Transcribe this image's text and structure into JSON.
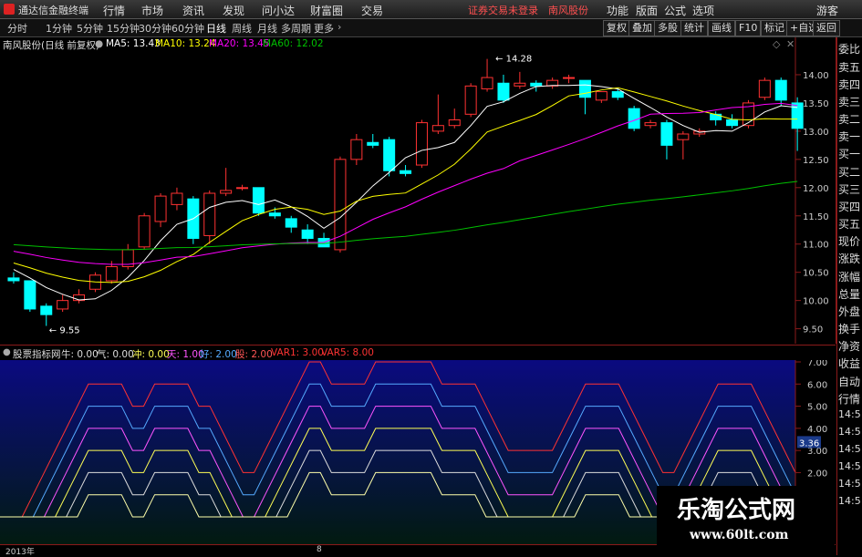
{
  "menu": {
    "app_name": "通达信金融终端",
    "items": [
      "行情",
      "市场",
      "资讯",
      "发现",
      "问小达",
      "财富圈",
      "交易"
    ],
    "notice": "证券交易未登录　南风股份",
    "right_items": [
      "功能",
      "版面",
      "公式",
      "选项",
      "游客"
    ]
  },
  "toolbar": {
    "tabs": [
      "分时",
      "1分钟",
      "5分钟",
      "15分钟",
      "30分钟",
      "60分钟",
      "日线",
      "周线",
      "月线",
      "多周期",
      "更多"
    ],
    "active_tab": "日线",
    "right_buttons": [
      "复权",
      "叠加",
      "多股",
      "统计",
      "画线",
      "F10",
      "标记",
      "+自选",
      "返回"
    ]
  },
  "chart_header": {
    "stock": "南风股份(日线 前复权)",
    "ma5": "MA5: 13.43",
    "ma10": "MA10: 13.24",
    "ma20": "MA20: 13.45",
    "ma60": "MA60: 12.02",
    "high_label": "14.28",
    "low_label": "9.55"
  },
  "sub_header": {
    "name": "股票指标网",
    "items": [
      {
        "label": "牛: 0.00",
        "color": "#dddddd"
      },
      {
        "label": "气: 0.00",
        "color": "#dddddd"
      },
      {
        "label": "冲: 0.00",
        "color": "#ffff55"
      },
      {
        "label": "天: 1.00",
        "color": "#ff55ff"
      },
      {
        "label": "好: 2.00",
        "color": "#55aaff"
      },
      {
        "label": "股: 2.00",
        "color": "#ff5555"
      },
      {
        "label": "VAR1: 3.00",
        "color": "#ff3333"
      },
      {
        "label": "VAR5: 8.00",
        "color": "#ff3333"
      }
    ],
    "current_value": "3.36"
  },
  "sidebar": {
    "items": [
      "委比",
      "卖五",
      "卖四",
      "卖三",
      "卖二",
      "卖一",
      "买一",
      "买二",
      "买三",
      "买四",
      "买五",
      "现价",
      "涨跌",
      "涨幅",
      "总量",
      "外盘",
      "换手",
      "净资",
      "收益",
      "自动",
      "行情",
      "14:5",
      "14:5",
      "14:5",
      "14:5",
      "14:5",
      "14:5"
    ]
  },
  "bottom": {
    "year_label": "2013年",
    "month_label": "8"
  },
  "watermark": {
    "title": "乐淘公式网",
    "url": "www.60lt.com"
  },
  "colors": {
    "up": "#ff3232",
    "down": "#00ffff",
    "ma5": "#ffffff",
    "ma10": "#ffff00",
    "ma20": "#ff00ff",
    "ma60": "#00c000",
    "subbg": "#0a0a78"
  },
  "chart_data": {
    "type": "candlestick",
    "ylim": [
      9.3,
      14.5
    ],
    "yticks": [
      9.5,
      10.0,
      10.5,
      11.0,
      11.5,
      12.0,
      12.5,
      13.0,
      13.5,
      14.0
    ],
    "candles": [
      {
        "o": 10.4,
        "h": 10.5,
        "c": 10.35,
        "l": 10.3
      },
      {
        "o": 10.35,
        "h": 10.35,
        "c": 9.85,
        "l": 9.8
      },
      {
        "o": 9.9,
        "h": 9.95,
        "c": 9.75,
        "l": 9.55
      },
      {
        "o": 9.85,
        "h": 10.1,
        "c": 10.0,
        "l": 9.8
      },
      {
        "o": 10.0,
        "h": 10.2,
        "c": 10.1,
        "l": 9.95
      },
      {
        "o": 10.2,
        "h": 10.5,
        "c": 10.45,
        "l": 10.15
      },
      {
        "o": 10.35,
        "h": 10.7,
        "c": 10.6,
        "l": 10.3
      },
      {
        "o": 10.6,
        "h": 11.0,
        "c": 10.9,
        "l": 10.55
      },
      {
        "o": 10.95,
        "h": 11.55,
        "c": 11.5,
        "l": 10.9
      },
      {
        "o": 11.4,
        "h": 11.9,
        "c": 11.85,
        "l": 11.3
      },
      {
        "o": 11.7,
        "h": 12.0,
        "c": 11.9,
        "l": 11.6
      },
      {
        "o": 11.8,
        "h": 11.85,
        "c": 11.1,
        "l": 11.0
      },
      {
        "o": 11.15,
        "h": 11.95,
        "c": 11.9,
        "l": 11.0
      },
      {
        "o": 11.9,
        "h": 12.35,
        "c": 11.95,
        "l": 11.85
      },
      {
        "o": 12.0,
        "h": 12.05,
        "c": 12.0,
        "l": 11.95
      },
      {
        "o": 12.0,
        "h": 12.0,
        "c": 11.55,
        "l": 11.5
      },
      {
        "o": 11.55,
        "h": 11.65,
        "c": 11.5,
        "l": 11.45
      },
      {
        "o": 11.45,
        "h": 11.5,
        "c": 11.3,
        "l": 11.2
      },
      {
        "o": 11.25,
        "h": 11.35,
        "c": 11.1,
        "l": 11.0
      },
      {
        "o": 11.1,
        "h": 11.2,
        "c": 10.95,
        "l": 10.95
      },
      {
        "o": 10.9,
        "h": 12.55,
        "c": 12.5,
        "l": 10.85
      },
      {
        "o": 12.5,
        "h": 12.95,
        "c": 12.85,
        "l": 12.4
      },
      {
        "o": 12.8,
        "h": 12.95,
        "c": 12.75,
        "l": 12.7
      },
      {
        "o": 12.85,
        "h": 12.9,
        "c": 12.3,
        "l": 12.2
      },
      {
        "o": 12.3,
        "h": 12.4,
        "c": 12.25,
        "l": 12.2
      },
      {
        "o": 12.4,
        "h": 13.2,
        "c": 13.15,
        "l": 12.35
      },
      {
        "o": 13.0,
        "h": 13.65,
        "c": 13.1,
        "l": 12.95
      },
      {
        "o": 13.1,
        "h": 13.4,
        "c": 13.2,
        "l": 13.05
      },
      {
        "o": 13.3,
        "h": 13.85,
        "c": 13.8,
        "l": 13.25
      },
      {
        "o": 13.75,
        "h": 14.28,
        "c": 13.95,
        "l": 13.7
      },
      {
        "o": 13.85,
        "h": 14.0,
        "c": 13.55,
        "l": 13.5
      },
      {
        "o": 13.8,
        "h": 14.05,
        "c": 13.85,
        "l": 13.75
      },
      {
        "o": 13.85,
        "h": 13.9,
        "c": 13.8,
        "l": 13.7
      },
      {
        "o": 13.8,
        "h": 13.95,
        "c": 13.9,
        "l": 13.75
      },
      {
        "o": 13.95,
        "h": 14.0,
        "c": 13.95,
        "l": 13.85
      },
      {
        "o": 13.9,
        "h": 13.9,
        "c": 13.6,
        "l": 13.3
      },
      {
        "o": 13.55,
        "h": 13.65,
        "c": 13.7,
        "l": 13.5
      },
      {
        "o": 13.7,
        "h": 13.75,
        "c": 13.6,
        "l": 13.55
      },
      {
        "o": 13.4,
        "h": 13.45,
        "c": 13.05,
        "l": 13.0
      },
      {
        "o": 13.1,
        "h": 13.2,
        "c": 13.15,
        "l": 13.05
      },
      {
        "o": 13.15,
        "h": 13.2,
        "c": 12.75,
        "l": 12.5
      },
      {
        "o": 12.85,
        "h": 13.0,
        "c": 12.95,
        "l": 12.5
      },
      {
        "o": 12.95,
        "h": 13.05,
        "c": 13.0,
        "l": 12.9
      },
      {
        "o": 13.3,
        "h": 13.35,
        "c": 13.2,
        "l": 13.1
      },
      {
        "o": 13.2,
        "h": 13.3,
        "c": 13.1,
        "l": 13.05
      },
      {
        "o": 13.1,
        "h": 13.55,
        "c": 13.5,
        "l": 13.05
      },
      {
        "o": 13.6,
        "h": 13.95,
        "c": 13.9,
        "l": 13.55
      },
      {
        "o": 13.9,
        "h": 13.95,
        "c": 13.55,
        "l": 13.45
      },
      {
        "o": 13.5,
        "h": 13.6,
        "c": 13.05,
        "l": 12.65
      }
    ],
    "indicator": {
      "ylim": [
        0,
        7
      ],
      "yticks": [
        1.0,
        2.0,
        3.0,
        4.0,
        5.0,
        6.0,
        7.0
      ]
    }
  }
}
